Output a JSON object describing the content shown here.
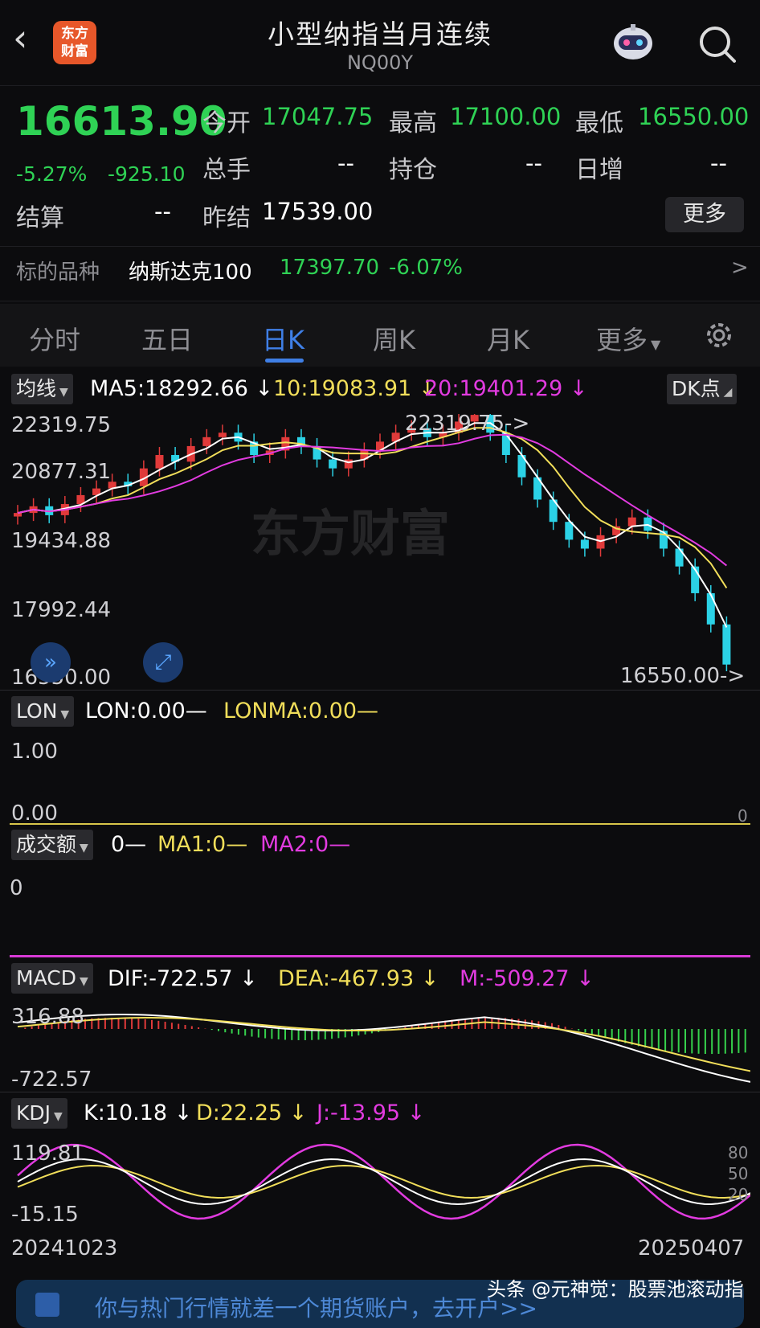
{
  "header": {
    "back_icon": "chevron-left-icon",
    "logo_text_1": "东方",
    "logo_text_2": "财富",
    "title": "小型纳指当月连续",
    "code": "NQ00Y"
  },
  "quote": {
    "last_price": "16613.90",
    "change_pct": "-5.27%",
    "change_abs": "-925.10",
    "open_label": "今开",
    "open_value": "17047.75",
    "high_label": "最高",
    "high_value": "17100.00",
    "low_label": "最低",
    "low_value": "16550.00",
    "volume_label": "总手",
    "volume_value": "--",
    "oi_label": "持仓",
    "oi_value": "--",
    "daily_inc_label": "日增",
    "daily_inc_value": "--",
    "settle_label": "结算",
    "settle_value": "--",
    "prev_settle_label": "昨结",
    "prev_settle_value": "17539.00",
    "more_label": "更多"
  },
  "underlying": {
    "label": "标的品种",
    "name": "纳斯达克100",
    "price": "17397.70",
    "change": "-6.07%",
    "arrow": ">"
  },
  "tabs": [
    {
      "label": "分时"
    },
    {
      "label": "五日"
    },
    {
      "label": "日K"
    },
    {
      "label": "周K"
    },
    {
      "label": "月K"
    },
    {
      "label": "更多"
    }
  ],
  "kline": {
    "indicator": "均线",
    "ma5": "MA5:18292.66",
    "ma10": "10:19083.91",
    "ma20": "20:19401.29",
    "dk_label": "DK点",
    "y_ticks": [
      "22319.75",
      "20877.31",
      "19434.88",
      "17992.44",
      "16550.00"
    ],
    "max_label": "22319.75->",
    "min_label": "16550.00->",
    "watermark": "东方财富"
  },
  "lon": {
    "indicator": "LON",
    "lon": "LON:0.00—",
    "lonma": "LONMA:0.00—",
    "y_top": "1.00",
    "y_bottom": "0.00",
    "right_tick": "0"
  },
  "turnover": {
    "indicator": "成交额",
    "v": "0—",
    "ma1": "MA1:0—",
    "ma2": "MA2:0—",
    "y_tick": "0"
  },
  "macd": {
    "indicator": "MACD",
    "dif": "DIF:-722.57",
    "dea": "DEA:-467.93",
    "m": "M:-509.27",
    "y_top": "316.88",
    "y_bottom": "-722.57"
  },
  "kdj": {
    "indicator": "KDJ",
    "k": "K:10.18",
    "d": "D:22.25",
    "j": "J:-13.95",
    "y_top": "119.81",
    "y_bottom": "-15.15",
    "r80": "80",
    "r50": "50",
    "r20": "20"
  },
  "dates": {
    "start": "20241023",
    "end": "20250407"
  },
  "footer": {
    "text": "你与热门行情就差一个期货账户，去开户>>",
    "watermark": "头条 @元神觉：股票池滚动指"
  },
  "colors": {
    "up": "#e03a3a",
    "down": "#2bd2e6",
    "ma5": "#ffffff",
    "ma10": "#f1de5a",
    "ma20": "#e23be0",
    "accent": "#3f7fe6",
    "td_setup": "#e0662a"
  },
  "chart_data": {
    "type": "candlestick",
    "title": "",
    "ylim": [
      16550.0,
      22319.75
    ],
    "y_ticks": [
      22319.75,
      20877.31,
      19434.88,
      17992.44,
      16550.0
    ],
    "x_range": [
      "20241023",
      "20250407"
    ],
    "series": [
      {
        "name": "MA5",
        "values": [
          18292.66
        ]
      },
      {
        "name": "MA10",
        "values": [
          19083.91
        ]
      },
      {
        "name": "MA20",
        "values": [
          19401.29
        ]
      }
    ],
    "annotations": {
      "high": 22319.75,
      "low": 16550.0
    }
  }
}
